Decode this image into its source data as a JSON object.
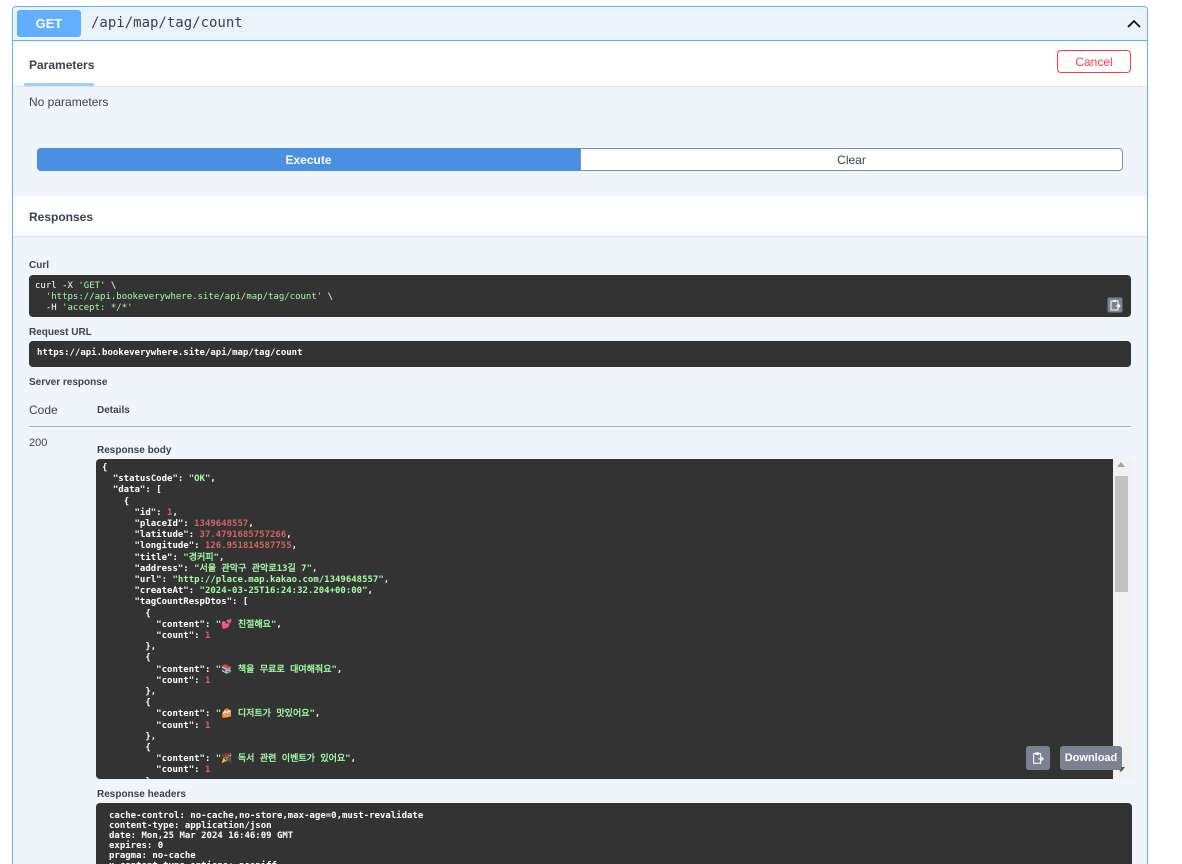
{
  "summary": {
    "method": "GET",
    "path": "/api/map/tag/count"
  },
  "parameters": {
    "tab_label": "Parameters",
    "cancel_label": "Cancel",
    "empty_text": "No parameters"
  },
  "actions": {
    "execute_label": "Execute",
    "clear_label": "Clear"
  },
  "responses": {
    "title": "Responses",
    "curl_label": "Curl",
    "curl_lines": [
      [
        "curl -X ",
        "'GET'",
        " \\"
      ],
      [
        "  ",
        "'https://api.bookeverywhere.site/api/map/tag/count'",
        " \\"
      ],
      [
        "  -H ",
        "'accept: */*'",
        ""
      ]
    ],
    "request_url_label": "Request URL",
    "request_url": "https://api.bookeverywhere.site/api/map/tag/count",
    "server_response_label": "Server response",
    "col_code": "Code",
    "col_details": "Details",
    "status_code": "200",
    "response_body_label": "Response body",
    "download_label": "Download",
    "response_headers_label": "Response headers",
    "response_headers": [
      "cache-control: no-cache,no-store,max-age=0,must-revalidate",
      "content-type: application/json",
      "date: Mon,25 Mar 2024 16:46:09 GMT",
      "expires: 0",
      "pragma: no-cache",
      "x-content-type-options: nosniff"
    ]
  },
  "body": {
    "statusCode": "\"OK\"",
    "id": "1",
    "placeId": "1349648557",
    "latitude": "37.4791685757266",
    "longitude": "126.951814587755",
    "title": "\"경커피\"",
    "address": "\"서울 관악구 관악로13길 7\"",
    "url": "\"http://place.map.kakao.com/1349648557\"",
    "createAt": "\"2024-03-25T16:24:32.204+00:00\"",
    "tags": [
      {
        "content": "\"💕 친절해요\"",
        "count": "1"
      },
      {
        "content": "\"📚 책을 무료로 대여해줘요\"",
        "count": "1"
      },
      {
        "content": "\"🍰 디저트가 맛있어요\"",
        "count": "1"
      },
      {
        "content": "\"🎉 독서 관련 이벤트가 있어요\"",
        "count": "1"
      }
    ]
  },
  "colors": {
    "get": "#61affe",
    "execute": "#4990e2",
    "cancel": "#f93e3e",
    "code_bg": "#333333",
    "string": "#a2fca2",
    "number": "#d36363"
  },
  "icons": {
    "collapse": "chevron-up-icon",
    "copy": "clipboard-icon"
  }
}
